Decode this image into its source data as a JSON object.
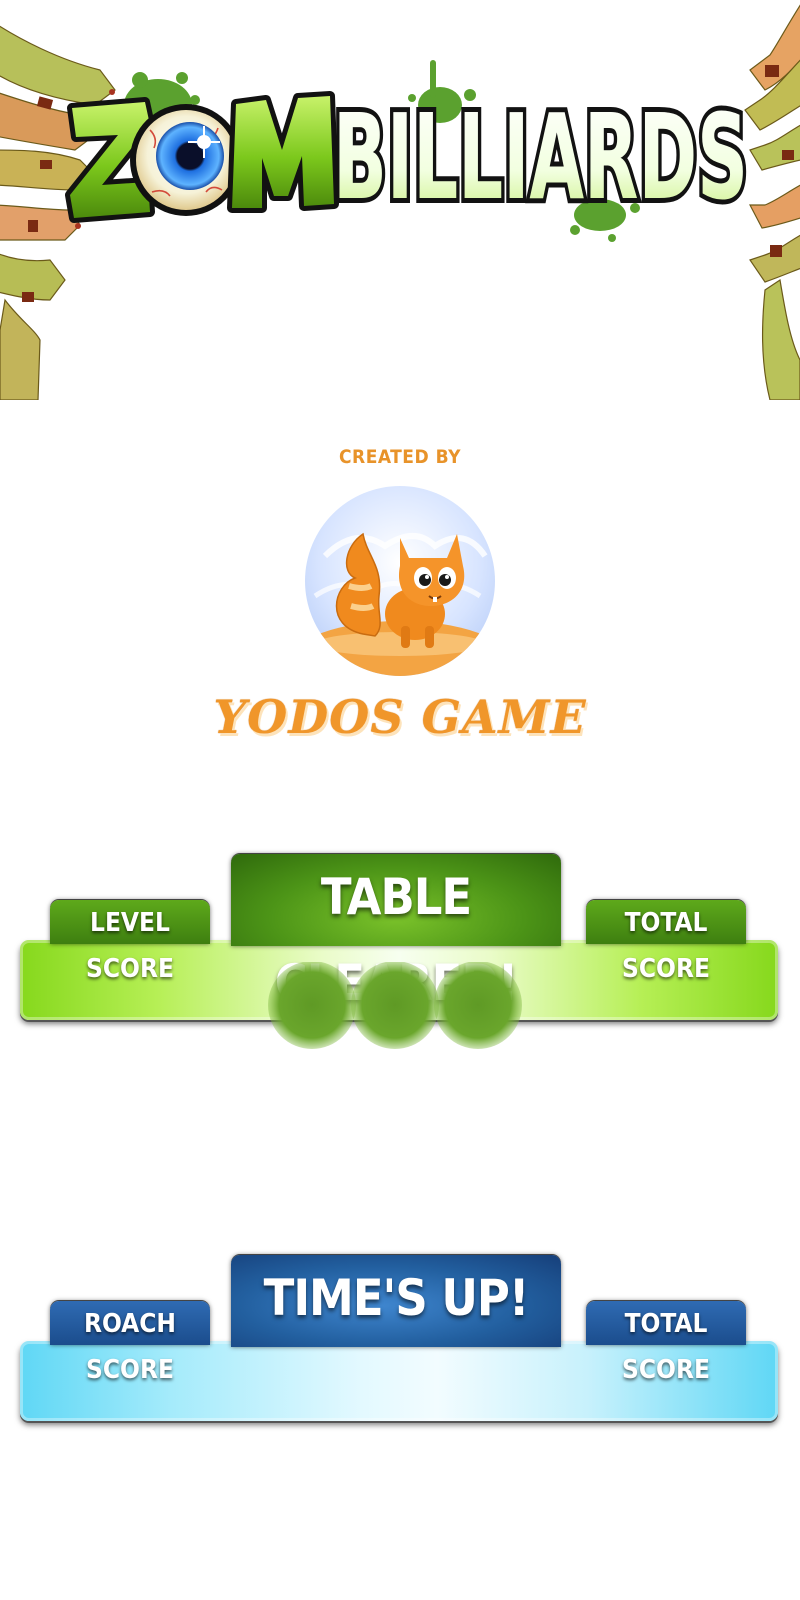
{
  "logo": {
    "title": "ZOMBILLIARDS",
    "title_part1": "Z",
    "title_part2": "M",
    "title_part3": "BILLIARDS"
  },
  "credits": {
    "created_by": "CREATED BY",
    "studio_name": "YODOS GAME"
  },
  "panels": [
    {
      "theme": "green",
      "headline": "TABLE CLEARED!",
      "left_tab": "LEVEL SCORE",
      "right_tab": "TOTAL SCORE",
      "accent": "#7ac22a"
    },
    {
      "theme": "blue",
      "headline": "TIME'S UP!",
      "left_tab": "ROACH SCORE",
      "right_tab": "TOTAL SCORE",
      "accent": "#3f86cf"
    }
  ],
  "colors": {
    "logo_green": "#7fce1f",
    "credit_orange": "#e8932a",
    "zombie_skin": "#b9c25a"
  }
}
